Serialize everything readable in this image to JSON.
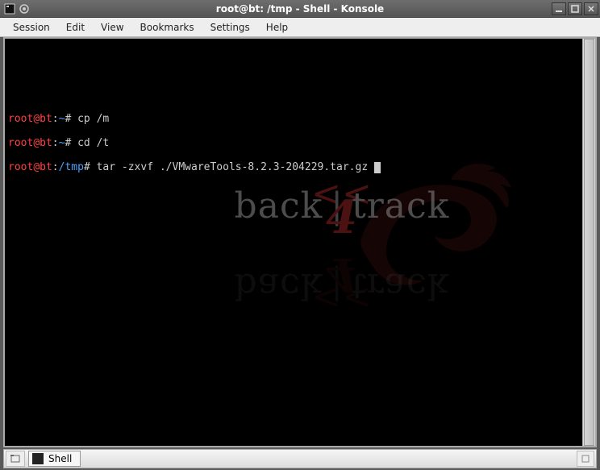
{
  "window": {
    "title": "root@bt: /tmp - Shell - Konsole"
  },
  "menubar": {
    "items": [
      "Session",
      "Edit",
      "View",
      "Bookmarks",
      "Settings",
      "Help"
    ]
  },
  "terminal": {
    "lines": [
      {
        "user": "root",
        "host": "bt",
        "path": "~",
        "cmd": "cp /m"
      },
      {
        "user": "root",
        "host": "bt",
        "path": "~",
        "cmd": "cd /t"
      },
      {
        "user": "root",
        "host": "bt",
        "path": "/tmp",
        "cmd": "tar -zxvf ./VMwareTools-8.2.3-204229.tar.gz "
      }
    ]
  },
  "background_art": {
    "arrows": "<<",
    "left_word": "back",
    "right_word": "track",
    "version": "4"
  },
  "taskbar": {
    "tab_label": "Shell"
  }
}
